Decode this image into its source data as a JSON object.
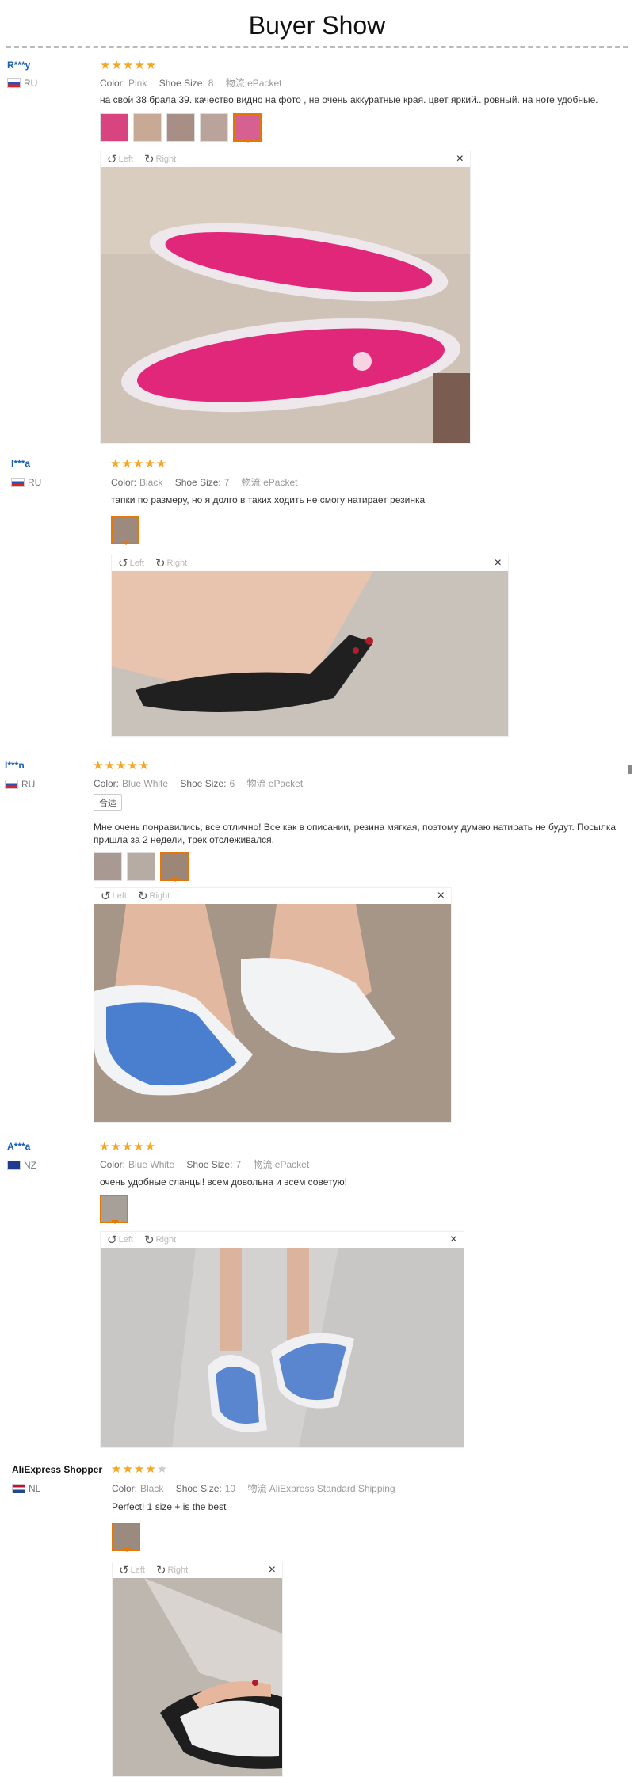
{
  "page_title": "Buyer Show",
  "rotate_left_label": "Left",
  "rotate_right_label": "Right",
  "labels": {
    "color": "Color:",
    "size": "Shoe Size:"
  },
  "colors": {
    "accent": "#e5770a",
    "star": "#f5a623",
    "link": "#1a5db8"
  },
  "reviews": [
    {
      "buyer": "R***y",
      "country": "RU",
      "rating": 5,
      "color": "Pink",
      "size": "8",
      "shipping": "物流 ePacket",
      "text": "на свой 38 брала 39. качество видно на фото , не очень аккуратные края. цвет яркий.. ровный. на ноге удобные.",
      "thumb_count": 5
    },
    {
      "buyer": "I***a",
      "country": "RU",
      "rating": 5,
      "color": "Black",
      "size": "7",
      "shipping": "物流 ePacket",
      "text": "тапки по размеру, но я долго в таких ходить не смогу натирает резинка",
      "thumb_count": 1
    },
    {
      "buyer": "I***n",
      "country": "RU",
      "rating": 5,
      "color": "Blue White",
      "size": "6",
      "shipping": "物流 ePacket",
      "tag": "合适",
      "text": "Мне очень понравились, все отлично! Все как в описании, резина мягкая, поэтому думаю натирать не будут. Посылка пришла за 2 недели, трек отслеживался.",
      "thumb_count": 3
    },
    {
      "buyer": "A***a",
      "country": "NZ",
      "rating": 5,
      "color": "Blue White",
      "size": "7",
      "shipping": "物流 ePacket",
      "text": "очень удобные сланцы! всем довольна и всем советую!",
      "thumb_count": 1
    },
    {
      "buyer": "AliExpress Shopper",
      "country": "NL",
      "rating": 4,
      "color": "Black",
      "size": "10",
      "shipping": "物流 AliExpress Standard Shipping",
      "text": "Perfect! 1 size + is the best",
      "thumb_count": 1
    }
  ]
}
